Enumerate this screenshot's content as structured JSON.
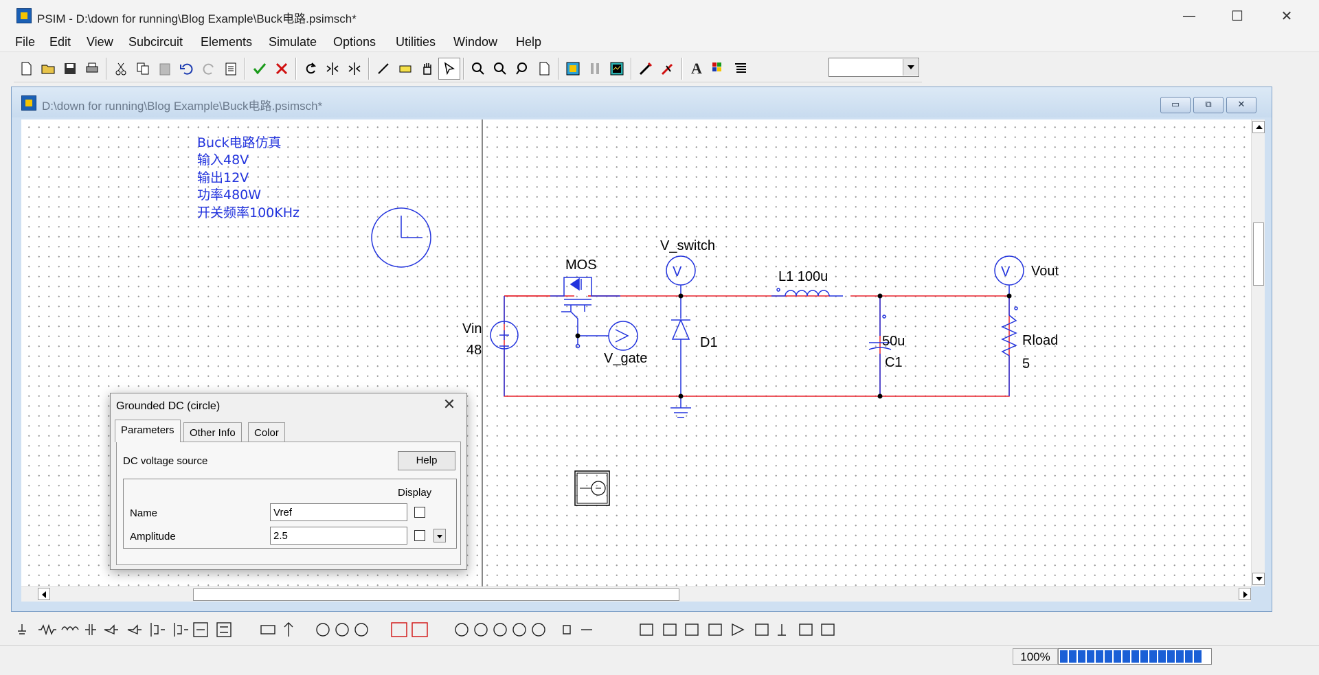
{
  "window": {
    "app_title": "PSIM - D:\\down for running\\Blog Example\\Buck电路.psimsch*",
    "minimize": "—",
    "maximize": "☐",
    "close": "✕"
  },
  "menu": [
    "File",
    "Edit",
    "View",
    "Subcircuit",
    "Elements",
    "Simulate",
    "Options",
    "Utilities",
    "Window",
    "Help"
  ],
  "child_window": {
    "title": "D:\\down for running\\Blog Example\\Buck电路.psimsch*",
    "min_label": "▭",
    "restore_label": "⧉",
    "close_label": "✕"
  },
  "schematic": {
    "notes": [
      "Buck电路仿真",
      "输入48V",
      "输出12V",
      "功率480W",
      "开关频率100KHz"
    ],
    "labels": {
      "mos": "MOS",
      "v_switch": "V_switch",
      "inductor": "L1  100u",
      "vout": "Vout",
      "vin": "Vin",
      "vin_value": "48",
      "v_gate": "V_gate",
      "diode": "D1",
      "cap_value": "50u",
      "cap_name": "C1",
      "rload": "Rload",
      "rload_value": "5",
      "voltmeter": "V"
    },
    "wire_color": "#e8202a",
    "component_color": "#2233dd",
    "note_color": "#2233dd"
  },
  "dialog": {
    "title": "Grounded DC (circle)",
    "close": "✕",
    "tabs": [
      "Parameters",
      "Other Info",
      "Color"
    ],
    "description": "DC voltage source",
    "help": "Help",
    "display_header": "Display",
    "fields": [
      {
        "label": "Name",
        "value": "Vref"
      },
      {
        "label": "Amplitude",
        "value": "2.5"
      }
    ]
  },
  "status": {
    "zoom": "100%",
    "progress_color": "#1a5fd6"
  }
}
